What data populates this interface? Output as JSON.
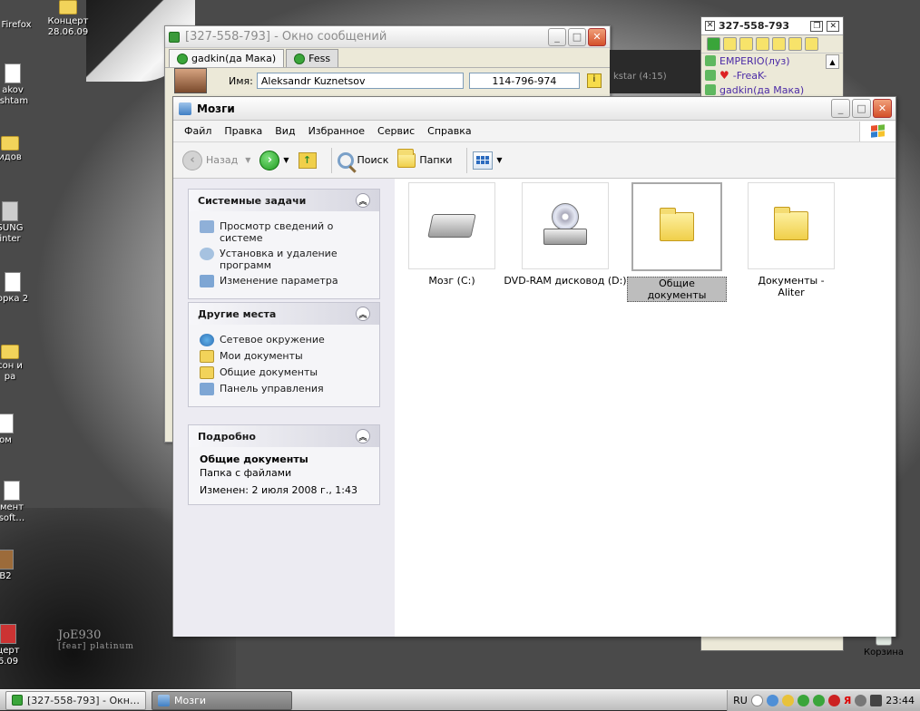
{
  "desktop": {
    "icons": [
      {
        "label": "Firefox"
      },
      {
        "label": "Концерт 28.06.09"
      },
      {
        "label": "akov ishtam"
      },
      {
        "label": "идов"
      },
      {
        "label": "SUNG inter"
      },
      {
        "label": "орка 2"
      },
      {
        "label": "сон и ра"
      },
      {
        "label": "ом"
      },
      {
        "label": "мент soft…"
      },
      {
        "label": "B2"
      },
      {
        "label": "церт 6.09"
      },
      {
        "label": "Корзина"
      }
    ],
    "watermark": {
      "line1": "JoE930",
      "line2": "[fear] platinum"
    }
  },
  "message_window": {
    "title": "[327-558-793] - Окно сообщений",
    "tabs": [
      {
        "label": "gadkin(да Мака)"
      },
      {
        "label": "Fess"
      }
    ],
    "name_label": "Имя:",
    "name_value": "Aleksandr  Kuznetsov",
    "uin_value": "114-796-974"
  },
  "media_player": {
    "track": "kstar (4:15)"
  },
  "contact_list": {
    "title": "327-558-793",
    "contacts": [
      {
        "name": "EMPERIO(луз)"
      },
      {
        "name": "-FreaK-"
      },
      {
        "name": "gadkin(да Мака)"
      }
    ]
  },
  "explorer": {
    "title": "Мозги",
    "menu": [
      "Файл",
      "Правка",
      "Вид",
      "Избранное",
      "Сервис",
      "Справка"
    ],
    "toolbar": {
      "back": "Назад",
      "search": "Поиск",
      "folders": "Папки"
    },
    "system_tasks": {
      "title": "Системные задачи",
      "items": [
        "Просмотр сведений о системе",
        "Установка и удаление программ",
        "Изменение параметра"
      ]
    },
    "other_places": {
      "title": "Другие места",
      "items": [
        "Сетевое окружение",
        "Мои документы",
        "Общие документы",
        "Панель управления"
      ]
    },
    "details": {
      "title": "Подробно",
      "name": "Общие документы",
      "type": "Папка с файлами",
      "modified": "Изменен: 2 июля 2008 г., 1:43"
    },
    "items": [
      {
        "label": "Мозг (C:)",
        "icon": "hard-drive-icon"
      },
      {
        "label": "DVD-RAM дисковод (D:)",
        "icon": "dvd-drive-icon"
      },
      {
        "label": "Общие документы",
        "icon": "folder-icon",
        "selected": true
      },
      {
        "label": "Документы - Aliter",
        "icon": "folder-icon"
      }
    ]
  },
  "taskbar": {
    "tasks": [
      {
        "label": "[327-558-793] - Окн…"
      },
      {
        "label": "Мозги"
      }
    ],
    "lang": "RU",
    "clock": "23:44"
  },
  "colors": {
    "selection": "#bdbdbd",
    "pane_bg": "#ecebf2",
    "icq_contact": "#4b2aa6"
  }
}
